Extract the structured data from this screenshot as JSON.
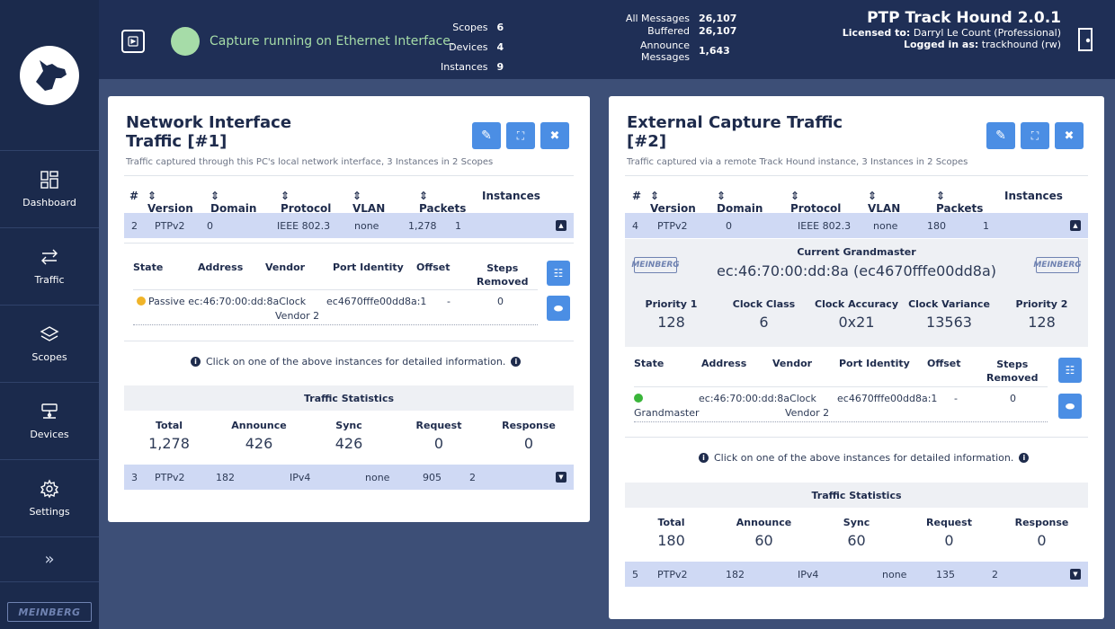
{
  "sidebar": {
    "nav": [
      {
        "label": "Dashboard",
        "icon": "dashboard-icon"
      },
      {
        "label": "Traffic",
        "icon": "traffic-arrows-icon"
      },
      {
        "label": "Scopes",
        "icon": "layers-icon"
      },
      {
        "label": "Devices",
        "icon": "network-device-icon"
      },
      {
        "label": "Settings",
        "icon": "gear-icon"
      }
    ],
    "expand": "»",
    "brand": "MEINBERG"
  },
  "topbar": {
    "status_text": "Capture running on Ethernet Interface.",
    "status_color": "#a6dca8",
    "counts": [
      {
        "label": "Scopes",
        "value": "6"
      },
      {
        "label": "Devices",
        "value": "4"
      },
      {
        "label": "Instances",
        "value": "9"
      }
    ],
    "messages": {
      "all_label": "All Messages",
      "all_value": "26,107",
      "buffered_label": "Buffered",
      "buffered_value": "26,107",
      "announce_label_1": "Announce",
      "announce_label_2": "Messages",
      "announce_value": "1,643"
    },
    "app_title": "PTP Track Hound 2.0.1",
    "licensed_label": "Licensed to:",
    "licensed_value": "Darryl Le Count (Professional)",
    "logged_label": "Logged in as:",
    "logged_value": "trackhound (rw)"
  },
  "panel1": {
    "title_1": "Network Interface",
    "title_2": "Traffic [#1]",
    "subtitle": "Traffic captured through this PC's local network interface, 3 Instances in 2 Scopes",
    "columns": [
      "#",
      "Version",
      "Domain",
      "Protocol",
      "VLAN",
      "Packets",
      "Instances"
    ],
    "rows": [
      {
        "num": "2",
        "version": "PTPv2",
        "domain": "0",
        "protocol": "IEEE 802.3",
        "vlan": "none",
        "packets": "1,278",
        "instances": "1"
      },
      {
        "num": "3",
        "version": "PTPv2",
        "domain": "182",
        "protocol": "IPv4",
        "vlan": "none",
        "packets": "905",
        "instances": "2"
      }
    ],
    "inst_cols": [
      "State",
      "Address",
      "Vendor",
      "Port Identity",
      "Offset",
      "Steps",
      "Removed"
    ],
    "inst": {
      "state": "Passive",
      "address": "ec:46:70:00:dd:8a",
      "vendor_1": "Clock",
      "vendor_2": "Vendor 2",
      "port": "ec4670fffe00dd8a:1",
      "offset": "-",
      "steps": "0",
      "dot_color": "#f0b429"
    },
    "note": "Click on one of the above instances for detailed information.",
    "stats_title": "Traffic Statistics",
    "stats": [
      {
        "k": "Total",
        "v": "1,278"
      },
      {
        "k": "Announce",
        "v": "426"
      },
      {
        "k": "Sync",
        "v": "426"
      },
      {
        "k": "Request",
        "v": "0"
      },
      {
        "k": "Response",
        "v": "0"
      }
    ]
  },
  "panel2": {
    "title_1": "External Capture Traffic",
    "title_2": "[#2]",
    "subtitle": "Traffic captured via a remote Track Hound instance, 3 Instances in 2 Scopes",
    "columns": [
      "#",
      "Version",
      "Domain",
      "Protocol",
      "VLAN",
      "Packets",
      "Instances"
    ],
    "rows": [
      {
        "num": "4",
        "version": "PTPv2",
        "domain": "0",
        "protocol": "IEEE 802.3",
        "vlan": "none",
        "packets": "180",
        "instances": "1"
      },
      {
        "num": "5",
        "version": "PTPv2",
        "domain": "182",
        "protocol": "IPv4",
        "vlan": "none",
        "packets": "135",
        "instances": "2"
      }
    ],
    "gm_title": "Current Grandmaster",
    "gm_value": "ec:46:70:00:dd:8a (ec4670fffe00dd8a)",
    "gm_logo": "MEINBERG",
    "clock": [
      {
        "k": "Priority 1",
        "v": "128"
      },
      {
        "k": "Clock Class",
        "v": "6"
      },
      {
        "k": "Clock Accuracy",
        "v": "0x21"
      },
      {
        "k": "Clock Variance",
        "v": "13563"
      },
      {
        "k": "Priority 2",
        "v": "128"
      }
    ],
    "inst_cols": [
      "State",
      "Address",
      "Vendor",
      "Port Identity",
      "Offset",
      "Steps",
      "Removed"
    ],
    "inst": {
      "state": "Grandmaster",
      "address": "ec:46:70:00:dd:8a",
      "vendor_1": "Clock",
      "vendor_2": "Vendor 2",
      "port": "ec4670fffe00dd8a:1",
      "offset": "-",
      "steps": "0",
      "dot_color": "#3ab53a"
    },
    "note": "Click on one of the above instances for detailed information.",
    "stats_title": "Traffic Statistics",
    "stats": [
      {
        "k": "Total",
        "v": "180"
      },
      {
        "k": "Announce",
        "v": "60"
      },
      {
        "k": "Sync",
        "v": "60"
      },
      {
        "k": "Request",
        "v": "0"
      },
      {
        "k": "Response",
        "v": "0"
      }
    ]
  }
}
